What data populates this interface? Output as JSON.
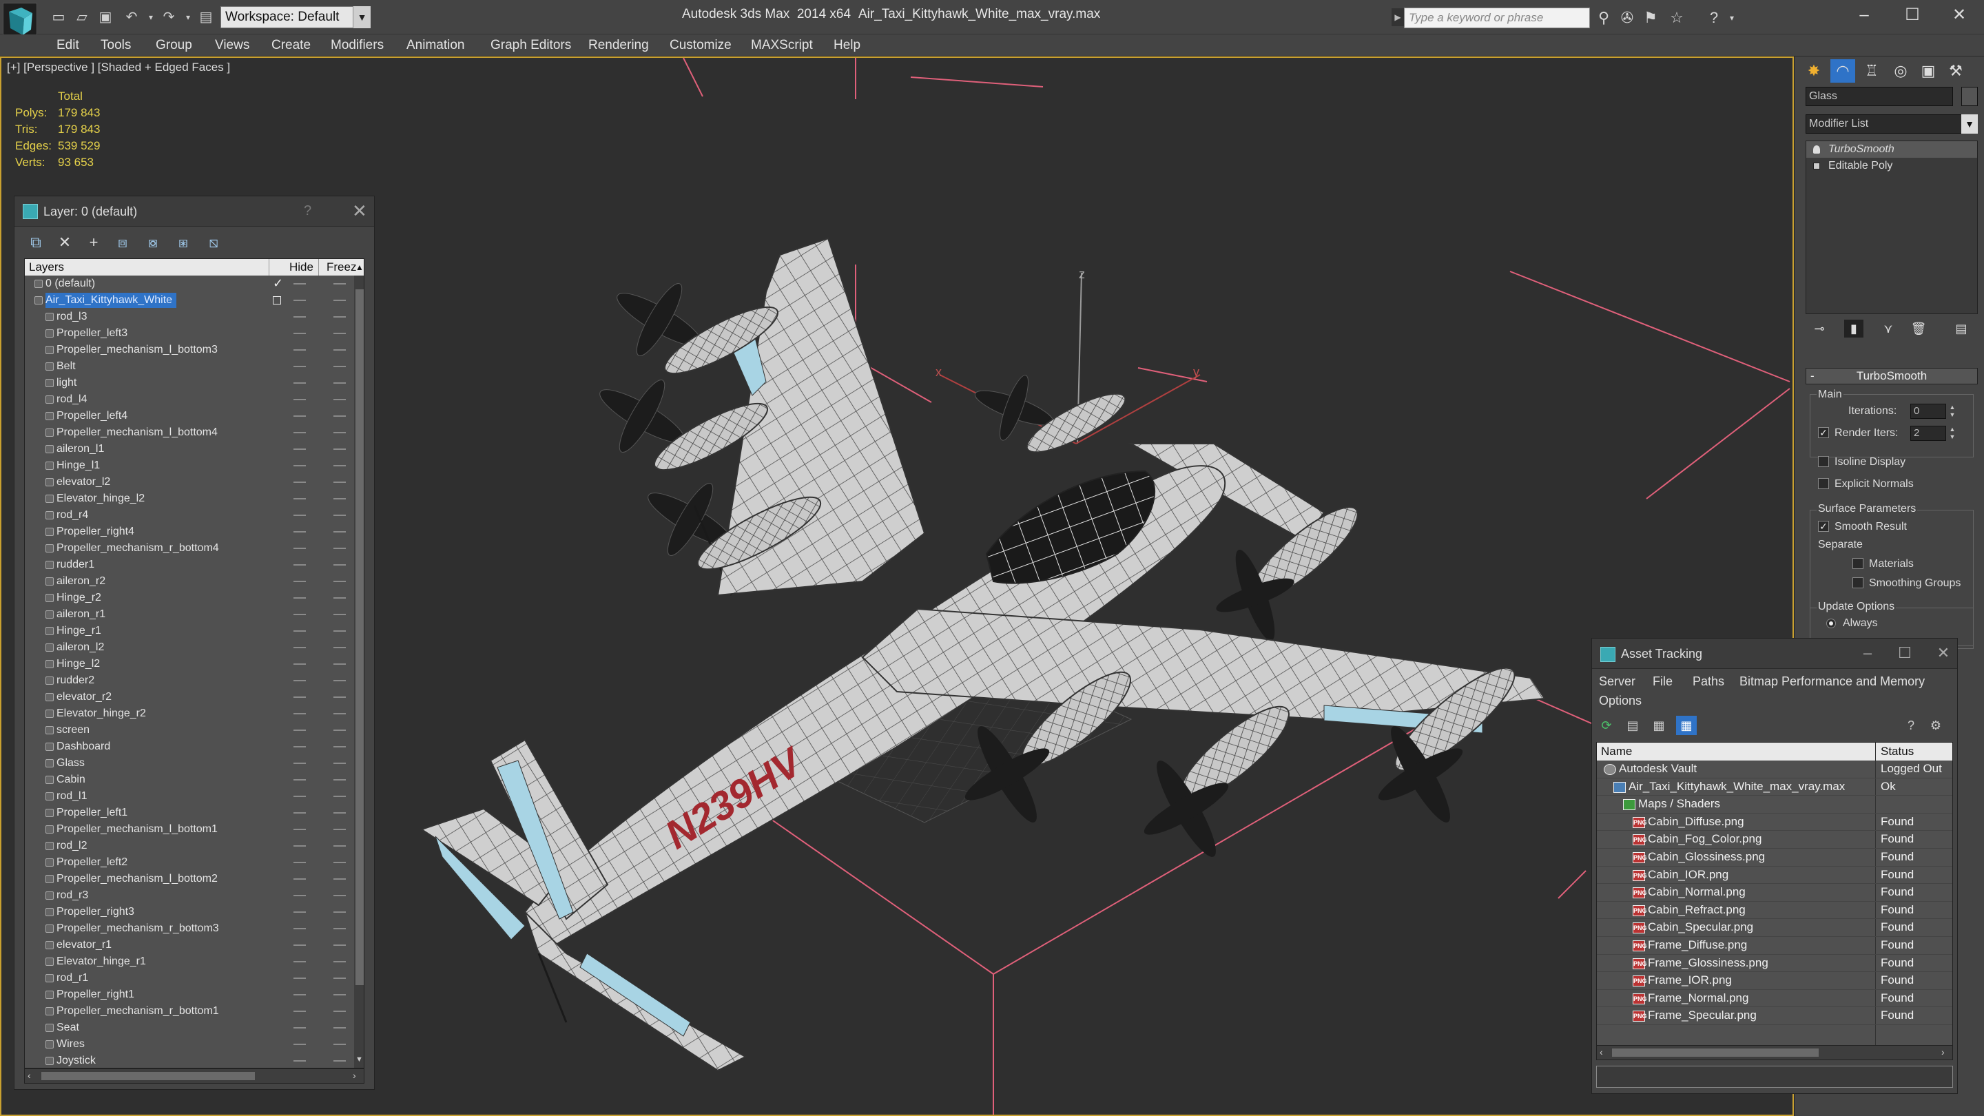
{
  "titlebar": {
    "workspace_value": "Workspace: Default",
    "app_title": "Autodesk 3ds Max  2014 x64",
    "file_title": "Air_Taxi_Kittyhawk_White_max_vray.max",
    "search_placeholder": "Type a keyword or phrase"
  },
  "menu": [
    "Edit",
    "Tools",
    "Group",
    "Views",
    "Create",
    "Modifiers",
    "Animation",
    "Graph Editors",
    "Rendering",
    "Customize",
    "MAXScript",
    "Help"
  ],
  "viewport": {
    "label": "[+] [Perspective ] [Shaded + Edged Faces ]",
    "stats_header": "Total",
    "stats": [
      {
        "k": "Polys:",
        "v": "179 843"
      },
      {
        "k": "Tris:",
        "v": "179 843"
      },
      {
        "k": "Edges:",
        "v": "539 529"
      },
      {
        "k": "Verts:",
        "v": "93 653"
      }
    ],
    "tail_number": "N239HV",
    "gizmo_x": "x",
    "gizmo_y": "y",
    "gizmo_z": "z"
  },
  "layer_explorer": {
    "title": "Layer: 0 (default)",
    "help": "?",
    "col_layers": "Layers",
    "col_hide": "Hide",
    "col_freeze": "Freez",
    "rows": [
      {
        "name": "0 (default)",
        "level": 0,
        "current": true
      },
      {
        "name": "Air_Taxi_Kittyhawk_White",
        "level": 0,
        "selected": true
      },
      {
        "name": "rod_l3",
        "level": 1
      },
      {
        "name": "Propeller_left3",
        "level": 1
      },
      {
        "name": "Propeller_mechanism_l_bottom3",
        "level": 1
      },
      {
        "name": "Belt",
        "level": 1
      },
      {
        "name": "light",
        "level": 1
      },
      {
        "name": "rod_l4",
        "level": 1
      },
      {
        "name": "Propeller_left4",
        "level": 1
      },
      {
        "name": "Propeller_mechanism_l_bottom4",
        "level": 1
      },
      {
        "name": "aileron_l1",
        "level": 1
      },
      {
        "name": "Hinge_l1",
        "level": 1
      },
      {
        "name": "elevator_l2",
        "level": 1
      },
      {
        "name": "Elevator_hinge_l2",
        "level": 1
      },
      {
        "name": "rod_r4",
        "level": 1
      },
      {
        "name": "Propeller_right4",
        "level": 1
      },
      {
        "name": "Propeller_mechanism_r_bottom4",
        "level": 1
      },
      {
        "name": "rudder1",
        "level": 1
      },
      {
        "name": "aileron_r2",
        "level": 1
      },
      {
        "name": "Hinge_r2",
        "level": 1
      },
      {
        "name": "aileron_r1",
        "level": 1
      },
      {
        "name": "Hinge_r1",
        "level": 1
      },
      {
        "name": "aileron_l2",
        "level": 1
      },
      {
        "name": "Hinge_l2",
        "level": 1
      },
      {
        "name": "rudder2",
        "level": 1
      },
      {
        "name": "elevator_r2",
        "level": 1
      },
      {
        "name": "Elevator_hinge_r2",
        "level": 1
      },
      {
        "name": "screen",
        "level": 1
      },
      {
        "name": "Dashboard",
        "level": 1
      },
      {
        "name": "Glass",
        "level": 1
      },
      {
        "name": "Cabin",
        "level": 1
      },
      {
        "name": "rod_l1",
        "level": 1
      },
      {
        "name": "Propeller_left1",
        "level": 1
      },
      {
        "name": "Propeller_mechanism_l_bottom1",
        "level": 1
      },
      {
        "name": "rod_l2",
        "level": 1
      },
      {
        "name": "Propeller_left2",
        "level": 1
      },
      {
        "name": "Propeller_mechanism_l_bottom2",
        "level": 1
      },
      {
        "name": "rod_r3",
        "level": 1
      },
      {
        "name": "Propeller_right3",
        "level": 1
      },
      {
        "name": "Propeller_mechanism_r_bottom3",
        "level": 1
      },
      {
        "name": "elevator_r1",
        "level": 1
      },
      {
        "name": "Elevator_hinge_r1",
        "level": 1
      },
      {
        "name": "rod_r1",
        "level": 1
      },
      {
        "name": "Propeller_right1",
        "level": 1
      },
      {
        "name": "Propeller_mechanism_r_bottom1",
        "level": 1
      },
      {
        "name": "Seat",
        "level": 1
      },
      {
        "name": "Wires",
        "level": 1
      },
      {
        "name": "Joystick",
        "level": 1
      }
    ]
  },
  "command_panel": {
    "object_name": "Glass",
    "modifier_list": "Modifier List",
    "stack": [
      {
        "name": "TurboSmooth",
        "active": true
      },
      {
        "name": "Editable Poly",
        "active": false
      }
    ],
    "rollout_title": "TurboSmooth",
    "main_label": "Main",
    "iterations_label": "Iterations:",
    "iterations_value": "0",
    "render_iters_label": "Render Iters:",
    "render_iters_value": "2",
    "isoline_label": "Isoline Display",
    "explicit_normals_label": "Explicit Normals",
    "surface_params_label": "Surface Parameters",
    "smooth_result_label": "Smooth Result",
    "separate_label": "Separate",
    "materials_label": "Materials",
    "smoothing_groups_label": "Smoothing Groups",
    "update_options_label": "Update Options",
    "always_label": "Always"
  },
  "asset_tracking": {
    "title": "Asset Tracking",
    "menu": [
      "Server",
      "File",
      "Paths",
      "Bitmap Performance and Memory",
      "Options"
    ],
    "col_name": "Name",
    "col_status": "Status",
    "rows": [
      {
        "name": "Autodesk Vault",
        "status": "Logged Out",
        "kind": "vault",
        "level": 0
      },
      {
        "name": "Air_Taxi_Kittyhawk_White_max_vray.max",
        "status": "Ok",
        "kind": "file",
        "level": 1
      },
      {
        "name": "Maps / Shaders",
        "status": "",
        "kind": "folder",
        "level": 2
      },
      {
        "name": "Cabin_Diffuse.png",
        "status": "Found",
        "kind": "png",
        "level": 3
      },
      {
        "name": "Cabin_Fog_Color.png",
        "status": "Found",
        "kind": "png",
        "level": 3
      },
      {
        "name": "Cabin_Glossiness.png",
        "status": "Found",
        "kind": "png",
        "level": 3
      },
      {
        "name": "Cabin_IOR.png",
        "status": "Found",
        "kind": "png",
        "level": 3
      },
      {
        "name": "Cabin_Normal.png",
        "status": "Found",
        "kind": "png",
        "level": 3
      },
      {
        "name": "Cabin_Refract.png",
        "status": "Found",
        "kind": "png",
        "level": 3
      },
      {
        "name": "Cabin_Specular.png",
        "status": "Found",
        "kind": "png",
        "level": 3
      },
      {
        "name": "Frame_Diffuse.png",
        "status": "Found",
        "kind": "png",
        "level": 3
      },
      {
        "name": "Frame_Glossiness.png",
        "status": "Found",
        "kind": "png",
        "level": 3
      },
      {
        "name": "Frame_IOR.png",
        "status": "Found",
        "kind": "png",
        "level": 3
      },
      {
        "name": "Frame_Normal.png",
        "status": "Found",
        "kind": "png",
        "level": 3
      },
      {
        "name": "Frame_Specular.png",
        "status": "Found",
        "kind": "png",
        "level": 3
      }
    ]
  }
}
